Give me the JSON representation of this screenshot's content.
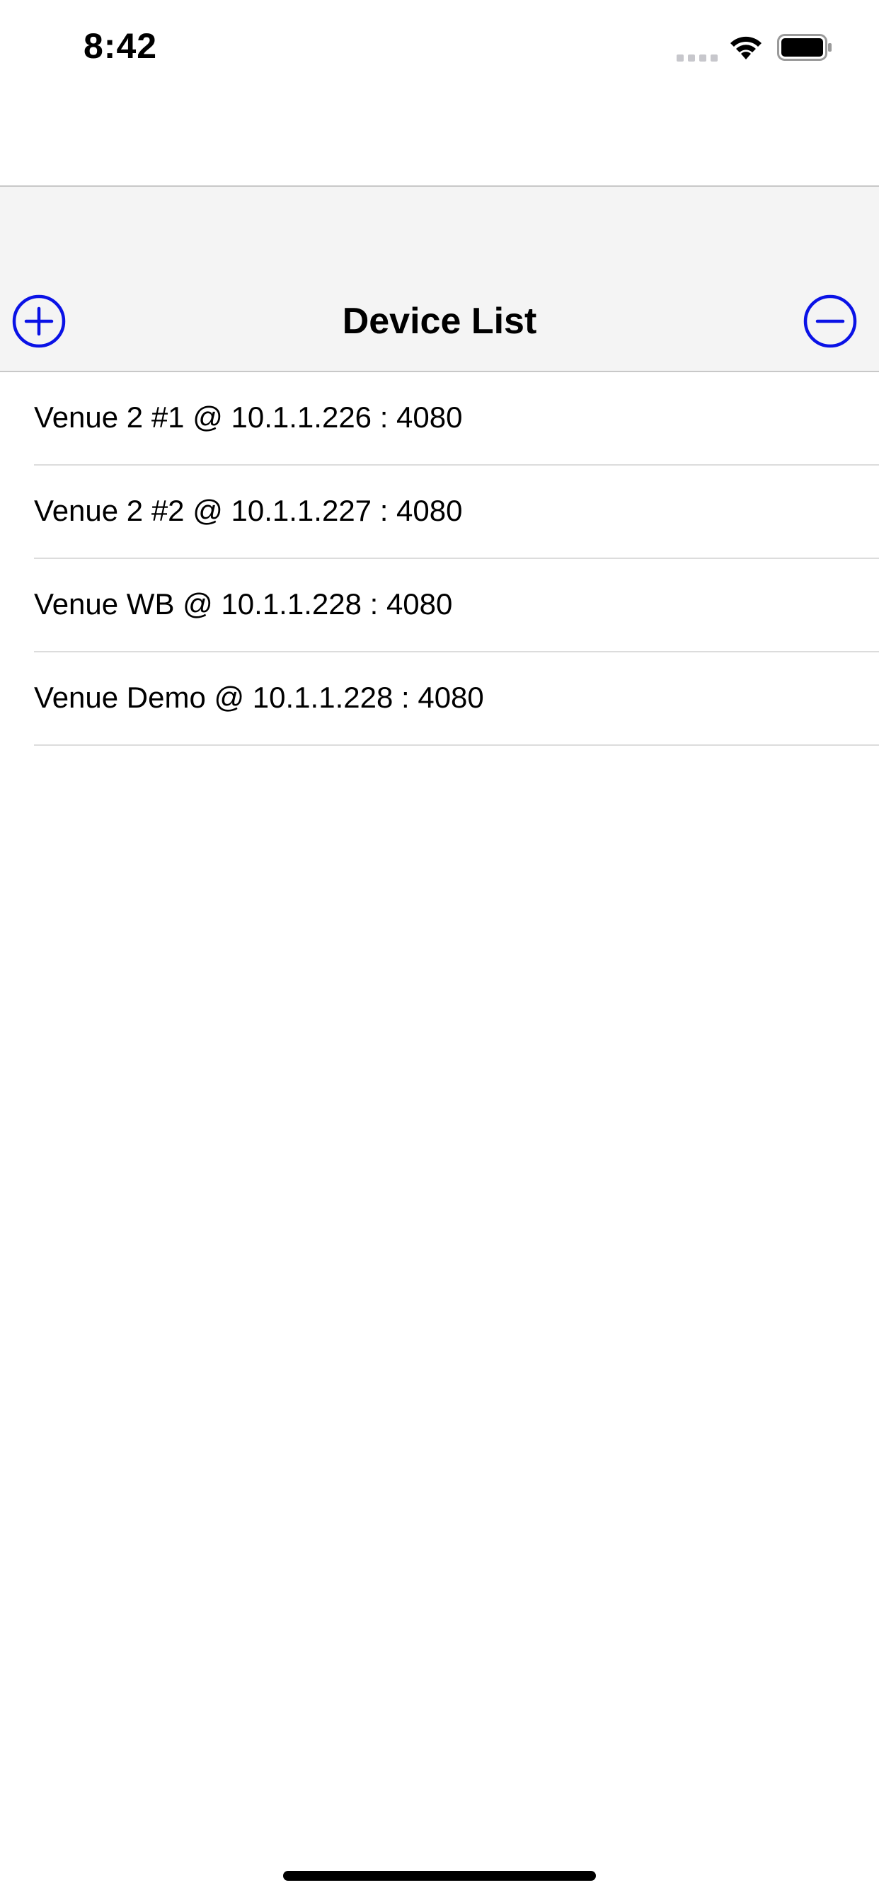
{
  "status_bar": {
    "time": "8:42"
  },
  "nav": {
    "title": "Device List",
    "accent_color": "#0a12e6"
  },
  "devices": [
    {
      "label": "Venue 2 #1 @ 10.1.1.226 : 4080"
    },
    {
      "label": "Venue 2 #2 @ 10.1.1.227 : 4080"
    },
    {
      "label": "Venue WB @ 10.1.1.228 : 4080"
    },
    {
      "label": "Venue Demo @ 10.1.1.228 : 4080"
    }
  ],
  "icons": {
    "add": "plus-circle-icon",
    "remove": "minus-circle-icon",
    "signal": "cellular-signal-icon",
    "wifi": "wifi-icon",
    "battery": "battery-icon"
  }
}
